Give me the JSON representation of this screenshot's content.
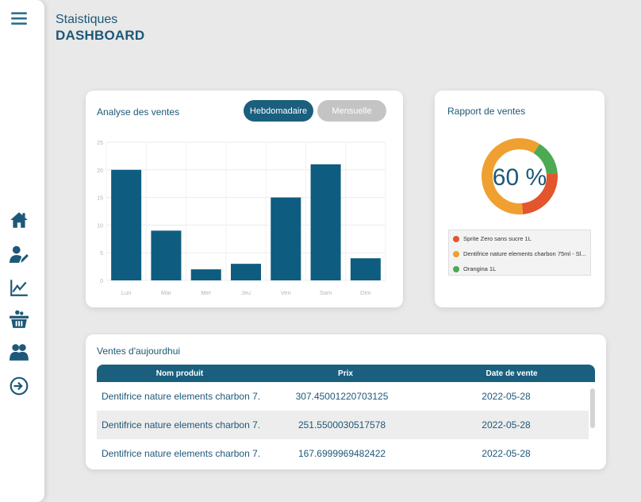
{
  "header": {
    "subtitle": "Staistiques",
    "title": "DASHBOARD"
  },
  "sidebar": {
    "icons": [
      "menu-icon",
      "home-icon",
      "user-edit-icon",
      "chart-line-icon",
      "basket-icon",
      "users-icon",
      "logout-icon"
    ]
  },
  "sales_chart": {
    "title": "Analyse des ventes",
    "toggle_weekly": "Hebdomadaire",
    "toggle_monthly": "Mensuelle"
  },
  "chart_data": [
    {
      "type": "bar",
      "title": "Analyse des ventes",
      "categories": [
        "Lun",
        "Mar",
        "Mer",
        "Jeu",
        "Ven",
        "Sam",
        "Dim"
      ],
      "values": [
        20,
        9,
        2,
        3,
        15,
        21,
        4
      ],
      "ylim": [
        0,
        25
      ],
      "yticks": [
        "0",
        "5",
        "10",
        "15",
        "20",
        "25"
      ],
      "grid": true,
      "color": "#0e5d80"
    },
    {
      "type": "pie",
      "title": "Rapport de ventes",
      "center_label": "60 %",
      "series": [
        {
          "name": "Sprite Zero sans sucre 1L",
          "value": 25,
          "color": "#e2552d"
        },
        {
          "name": "Dentifrice nature elements charbon 75ml - Sl...",
          "value": 60,
          "color": "#f0a030"
        },
        {
          "name": "Orangina 1L",
          "value": 15,
          "color": "#4caa52"
        }
      ]
    }
  ],
  "report": {
    "title": "Rapport de ventes",
    "center_label": "60 %"
  },
  "today": {
    "title": "Ventes d'aujourdhui",
    "columns": [
      "Nom produit",
      "Prix",
      "Date de vente"
    ],
    "rows": [
      [
        "Dentifrice nature elements charbon 7...",
        "307.45001220703125",
        "2022-05-28"
      ],
      [
        "Dentifrice nature elements charbon 7...",
        "251.5500030517578",
        "2022-05-28"
      ],
      [
        "Dentifrice nature elements charbon 7...",
        "167.6999969482422",
        "2022-05-28"
      ]
    ]
  },
  "colors": {
    "primary": "#1a5f7e",
    "inactive": "#c4c4c4",
    "background": "#e9e9e9"
  }
}
